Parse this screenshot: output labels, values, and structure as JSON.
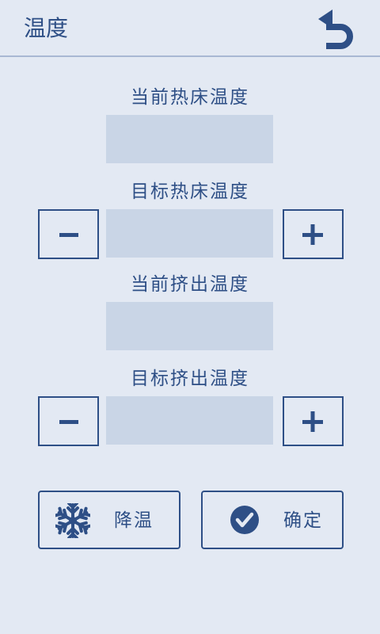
{
  "header": {
    "title": "温度"
  },
  "sections": [
    {
      "label": "当前热床温度",
      "value": ""
    },
    {
      "label": "目标热床温度",
      "value": ""
    },
    {
      "label": "当前挤出温度",
      "value": ""
    },
    {
      "label": "目标挤出温度",
      "value": ""
    }
  ],
  "actions": {
    "cooldown_label": "降温",
    "confirm_label": "确定"
  },
  "icons": {
    "back": "back-arrow-icon",
    "minus": "minus-icon",
    "plus": "plus-icon",
    "cooldown": "snowflake-icon",
    "confirm": "check-circle-icon"
  },
  "colors": {
    "background": "#e3e9f3",
    "accent": "#2e4f86",
    "field": "#c9d5e6"
  }
}
